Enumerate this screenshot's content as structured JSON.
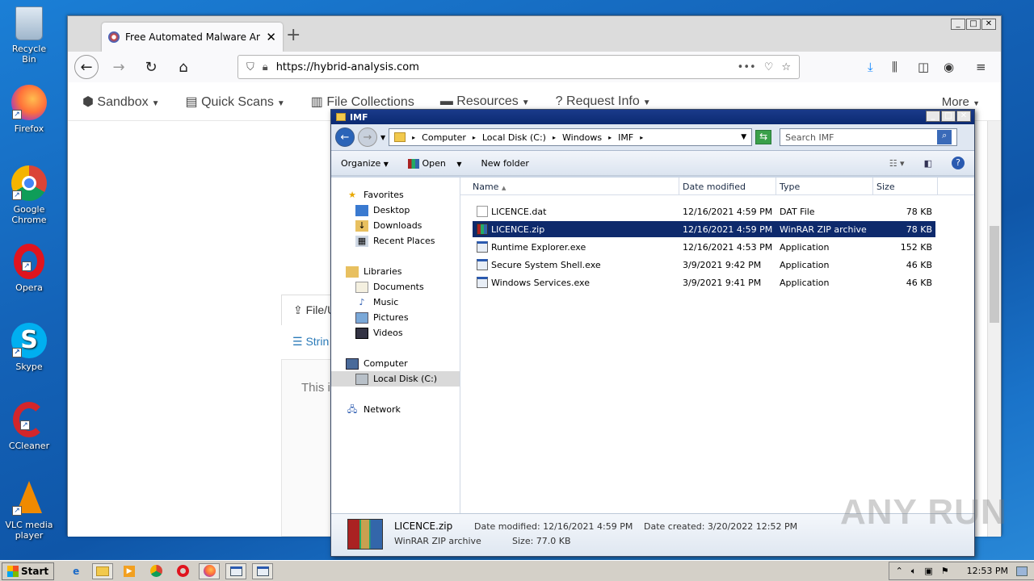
{
  "desktop": {
    "icons": [
      {
        "label": "Recycle Bin",
        "icon": "recycle-bin-icon"
      },
      {
        "label": "Firefox",
        "icon": "firefox-icon"
      },
      {
        "label": "Google Chrome",
        "icon": "chrome-icon"
      },
      {
        "label": "Opera",
        "icon": "opera-icon"
      },
      {
        "label": "Skype",
        "icon": "skype-icon"
      },
      {
        "label": "CCleaner",
        "icon": "ccleaner-icon"
      },
      {
        "label": "VLC media player",
        "icon": "vlc-icon"
      }
    ]
  },
  "browser": {
    "tab_title": "Free Automated Malware Analysis",
    "url": "https://hybrid-analysis.com",
    "menu_dots": "•••",
    "nav_items": [
      "Sandbox",
      "Quick Scans",
      "File Collections",
      "Resources",
      "Request Info"
    ],
    "more": "More",
    "partial_upload": "File/U",
    "partial_strings": "Strin",
    "partial_text": "This i"
  },
  "explorer": {
    "title": "IMF",
    "breadcrumbs": [
      "Computer",
      "Local Disk (C:)",
      "Windows",
      "IMF"
    ],
    "search_placeholder": "Search IMF",
    "commands": {
      "organize": "Organize",
      "open": "Open",
      "new_folder": "New folder"
    },
    "nav": {
      "favorites": "Favorites",
      "desktop": "Desktop",
      "downloads": "Downloads",
      "recent": "Recent Places",
      "libraries": "Libraries",
      "documents": "Documents",
      "music": "Music",
      "pictures": "Pictures",
      "videos": "Videos",
      "computer": "Computer",
      "local_disk": "Local Disk (C:)",
      "network": "Network"
    },
    "columns": {
      "name": "Name",
      "date": "Date modified",
      "type": "Type",
      "size": "Size"
    },
    "files": [
      {
        "name": "LICENCE.dat",
        "date": "12/16/2021 4:59 PM",
        "type": "DAT File",
        "size": "78 KB"
      },
      {
        "name": "LICENCE.zip",
        "date": "12/16/2021 4:59 PM",
        "type": "WinRAR ZIP archive",
        "size": "78 KB"
      },
      {
        "name": "Runtime Explorer.exe",
        "date": "12/16/2021 4:53 PM",
        "type": "Application",
        "size": "152 KB"
      },
      {
        "name": "Secure System Shell.exe",
        "date": "3/9/2021 9:42 PM",
        "type": "Application",
        "size": "46 KB"
      },
      {
        "name": "Windows Services.exe",
        "date": "3/9/2021 9:41 PM",
        "type": "Application",
        "size": "46 KB"
      }
    ],
    "details": {
      "name": "LICENCE.zip",
      "type": "WinRAR ZIP archive",
      "modified": "Date modified: 12/16/2021 4:59 PM",
      "size": "Size: 77.0 KB",
      "created": "Date created: 3/20/2022 12:52 PM"
    }
  },
  "taskbar": {
    "start": "Start",
    "clock": "12:53 PM"
  },
  "watermark": "ANY RUN"
}
